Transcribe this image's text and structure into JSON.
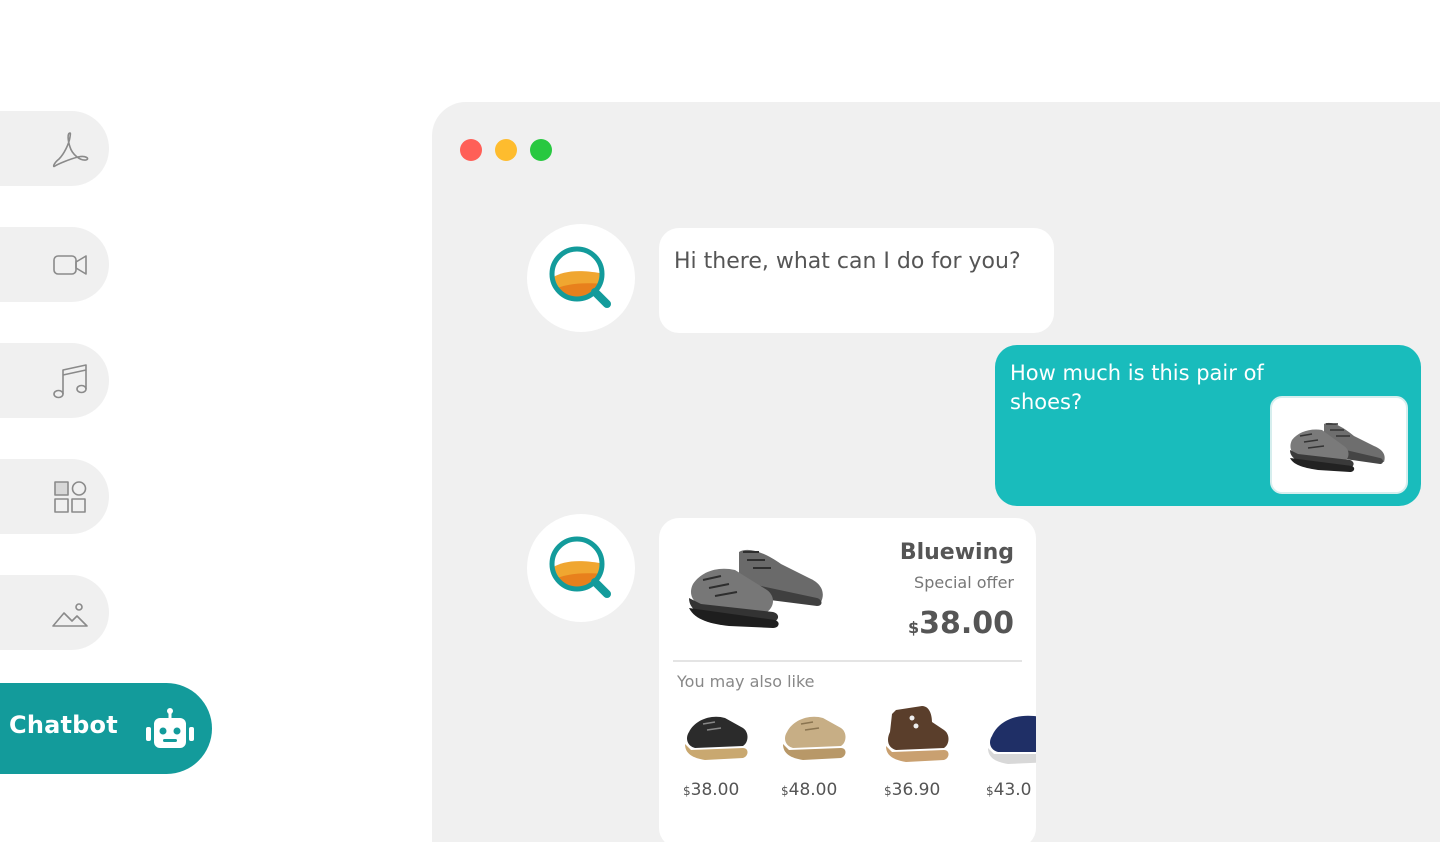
{
  "sidebar": {
    "items": [
      {
        "name": "pdf",
        "icon": "pdf-icon"
      },
      {
        "name": "video",
        "icon": "video-camera-icon"
      },
      {
        "name": "music",
        "icon": "music-note-icon"
      },
      {
        "name": "apps",
        "icon": "apps-grid-icon"
      },
      {
        "name": "image",
        "icon": "image-icon"
      }
    ],
    "chatbot": {
      "label": "Chatbot",
      "icon": "robot-icon"
    }
  },
  "window": {
    "controls": [
      "close",
      "minimize",
      "maximize"
    ]
  },
  "chat": {
    "messages": [
      {
        "sender": "bot",
        "text": "Hi there, what can I do for you?"
      },
      {
        "sender": "user",
        "text": "How much is this pair of shoes?",
        "attachment": "gray-sneaker-image"
      }
    ],
    "product": {
      "brand": "Bluewing",
      "label": "Special offer",
      "currency": "$",
      "price": "38.00",
      "also_like_label": "You may also like",
      "recommendations": [
        {
          "currency": "$",
          "price": "38.00",
          "color": "black"
        },
        {
          "currency": "$",
          "price": "48.00",
          "color": "tan"
        },
        {
          "currency": "$",
          "price": "36.90",
          "color": "brown"
        },
        {
          "currency": "$",
          "price": "43.0",
          "color": "navy"
        }
      ]
    }
  },
  "colors": {
    "accent": "#139b9b",
    "user_bubble": "#19bcbc",
    "window_bg": "#f0f0f0",
    "close": "#ff5f57",
    "minimize": "#febc2e",
    "maximize": "#28c840"
  }
}
